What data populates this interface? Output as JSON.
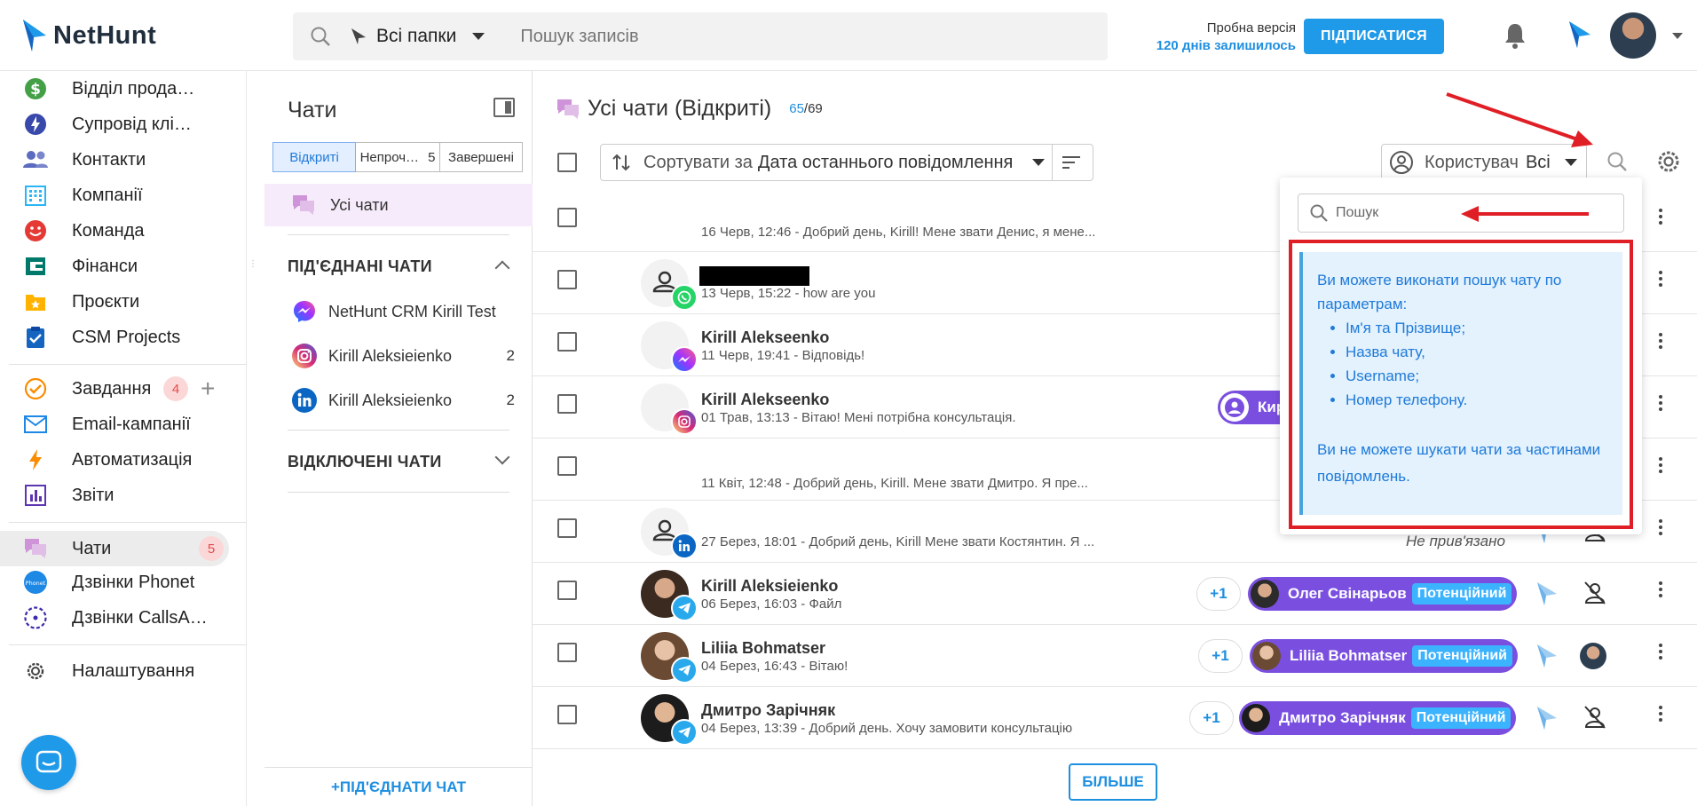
{
  "header": {
    "logo_text": "NetHunt",
    "folder_select": "Всі папки",
    "search_placeholder": "Пошук записів",
    "trial_label": "Пробна версія",
    "trial_days": "120 днів залишилось",
    "subscribe_label": "ПІДПИСАТИСЯ"
  },
  "sidebar": {
    "items": [
      {
        "label": "Відділ прода…"
      },
      {
        "label": "Супровід клі…"
      },
      {
        "label": "Контакти"
      },
      {
        "label": "Компанії"
      },
      {
        "label": "Команда"
      },
      {
        "label": "Фінанси"
      },
      {
        "label": "Проєкти"
      },
      {
        "label": "CSM Projects"
      },
      {
        "label": "Завдання",
        "badge": "4"
      },
      {
        "label": "Email-кампанії"
      },
      {
        "label": "Автоматизація"
      },
      {
        "label": "Звіти"
      },
      {
        "label": "Чати",
        "badge": "5"
      },
      {
        "label": "Дзвінки Phonet"
      },
      {
        "label": "Дзвінки CallsA…"
      },
      {
        "label": "Налаштування"
      }
    ],
    "plus": "+",
    "phonet_logo_text": "Phonet"
  },
  "chats_panel": {
    "title": "Чати",
    "tabs": [
      {
        "label": "Відкриті"
      },
      {
        "label": "Непроч…",
        "count": "5"
      },
      {
        "label": "Завершені"
      }
    ],
    "all_chats": "Усі чати",
    "connected_title": "ПІД'ЄДНАНІ ЧАТИ",
    "connected": [
      {
        "name": "NetHunt CRM Kirill Test",
        "count": ""
      },
      {
        "name": "Kirill Aleksieienko",
        "count": "2"
      },
      {
        "name": "Kirill Aleksieienko",
        "count": "2"
      }
    ],
    "disconnected_title": "ВІДКЛЮЧЕНІ ЧАТИ",
    "connect_button": "+ПІД'ЄДНАТИ ЧАТ"
  },
  "main": {
    "title": "Усі чати (Відкриті)",
    "count_open": "65",
    "count_total": "/69",
    "sort_prefix": "Сортувати за",
    "sort_value": "Дата останнього повідомлення",
    "user_label": "Користувач",
    "user_value": "Всі",
    "rows": [
      {
        "name": "",
        "msg": "16 Черв, 12:46 - Добрий день, Kirill! Мене звати Денис, я мене..."
      },
      {
        "name": "",
        "msg": "13 Черв, 15:22 - how are you"
      },
      {
        "name": "Kirill Alekseenko",
        "msg": "11 Черв, 19:41 - Відповідь!"
      },
      {
        "name": "Kirill Alekseenko",
        "msg": "01 Трав, 13:13 - Вітаю! Мені потрібна консультація.",
        "owner_partial": "Кир"
      },
      {
        "name": "",
        "msg": "11 Квіт, 12:48 - Добрий день, Kirill. Мене звати Дмитро. Я пре..."
      },
      {
        "name": "",
        "msg": "27 Берез, 18:01 - Добрий день, Kirill Мене звати Костянтин. Я ...",
        "unassigned": "Не прив'язано"
      },
      {
        "name": "Kirill Aleksieienko",
        "msg": "06 Берез, 16:03 - Файл",
        "plus": "+1",
        "owner": "Олег Свінарьов",
        "status": "Потенційний"
      },
      {
        "name": "Liliia Bohmatser",
        "msg": "04 Берез, 16:43 - Вітаю!",
        "plus": "+1",
        "owner": "Liliia Bohmatser",
        "status": "Потенційний"
      },
      {
        "name": "Дмитро Зарічняк",
        "msg": "04 Берез, 13:39 - Добрий день. Хочу замовити консультацію",
        "plus": "+1",
        "owner": "Дмитро Зарічняк",
        "status": "Потенційний"
      }
    ],
    "more_button": "БІЛЬШЕ"
  },
  "search_popup": {
    "placeholder": "Пошук",
    "info_intro": "Ви можете виконати пошук чату по параметрам:",
    "info_items": [
      "Ім'я та Прізвище;",
      "Назва чату,",
      "Username;",
      "Номер телефону."
    ],
    "info_note": "Ви не можете шукати чати за частинами повідомлень."
  },
  "colors": {
    "brand_blue": "#1f9ae9",
    "accent_purple": "#7a4fe0",
    "annotation_red": "#e01e25",
    "info_bg": "#e3f2fd"
  }
}
